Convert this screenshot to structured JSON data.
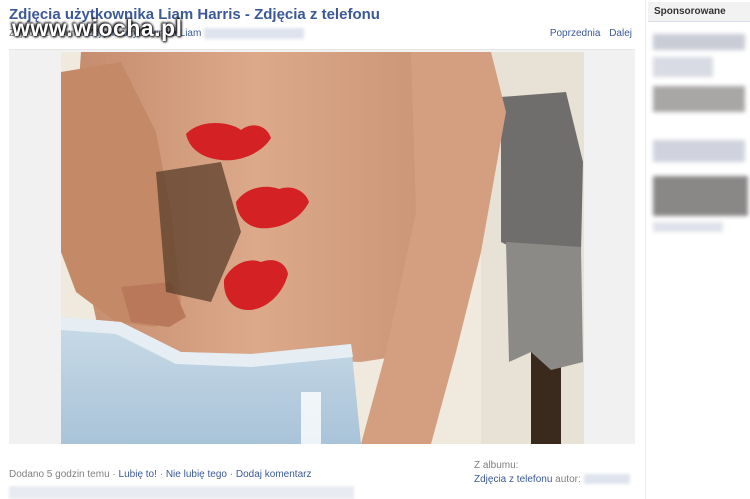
{
  "watermark": {
    "text": "www.wiocha.pl"
  },
  "header": {
    "title": "Zdjęcia użytkownika Liam Harris - Zdjęcia z telefonu",
    "subline_prefix": "Zdjęcia z albumu",
    "subline_link": "Zdjęcia użytkownika Liam",
    "prev": "Poprzednia",
    "next": "Dalej"
  },
  "footer": {
    "added": "Dodano 5 godzin temu",
    "sep": "·",
    "like": "Lubię to!",
    "dislike": "Nie lubię tego",
    "comment": "Dodaj komentarz"
  },
  "album": {
    "label": "Z albumu:",
    "name": "Zdjęcia z telefonu",
    "author_label": "autor:"
  },
  "sidebar": {
    "title": "Sponsorowane"
  },
  "colors": {
    "link": "#3b5998",
    "lip": "#d32124"
  },
  "icons": {
    "photo": "tattoo-photo"
  }
}
